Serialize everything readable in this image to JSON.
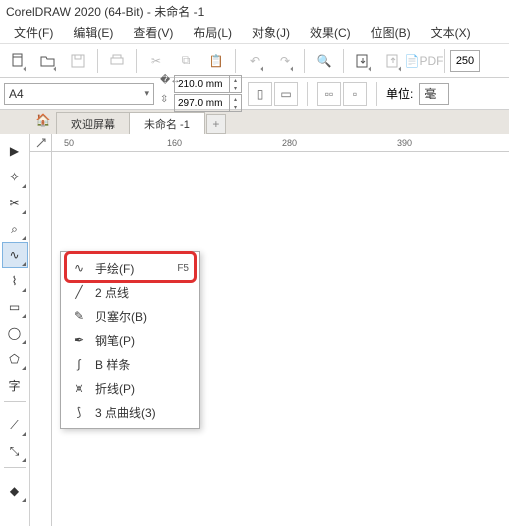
{
  "title": "CorelDRAW 2020 (64-Bit) - 未命名 -1",
  "menu": {
    "file": "文件(F)",
    "edit": "编辑(E)",
    "view": "查看(V)",
    "layout": "布局(L)",
    "object": "对象(J)",
    "effects": "效果(C)",
    "bitmap": "位图(B)",
    "text": "文本(X)"
  },
  "toolbar": {
    "pdf": "PDF",
    "hundred": "250"
  },
  "prop": {
    "pagesize": "A4",
    "width": "210.0 mm",
    "height": "297.0 mm",
    "units_label": "单位:",
    "units_val": "毫"
  },
  "tabs": {
    "welcome": "欢迎屏幕",
    "doc": "未命名 -1",
    "plus": "+"
  },
  "ruler": {
    "t50": "50",
    "t160": "160",
    "t280": "280",
    "t390": "390"
  },
  "tools": {
    "pick": "▶",
    "shape": "✧",
    "crop": "✂",
    "zoom": "⌕",
    "freehand": "∿",
    "smart": "⌇",
    "rect": "▭",
    "ellipse": "◯",
    "poly": "⬠",
    "text": "字",
    "dim": "⟋",
    "conn": "⤡",
    "interactive": "◆"
  },
  "flyout": {
    "freehand": {
      "ico": "∿",
      "label": "手绘(F)",
      "sc": "F5"
    },
    "twopoint": {
      "ico": "╱",
      "label": "2 点线"
    },
    "bezier": {
      "ico": "✎",
      "label": "贝塞尔(B)"
    },
    "pen": {
      "ico": "✒",
      "label": "钢笔(P)"
    },
    "bspline": {
      "ico": "∫",
      "label": "B 样条"
    },
    "polyline": {
      "ico": "⩙",
      "label": "折线(P)"
    },
    "threept": {
      "ico": "⟆",
      "label": "3 点曲线(3)"
    }
  }
}
